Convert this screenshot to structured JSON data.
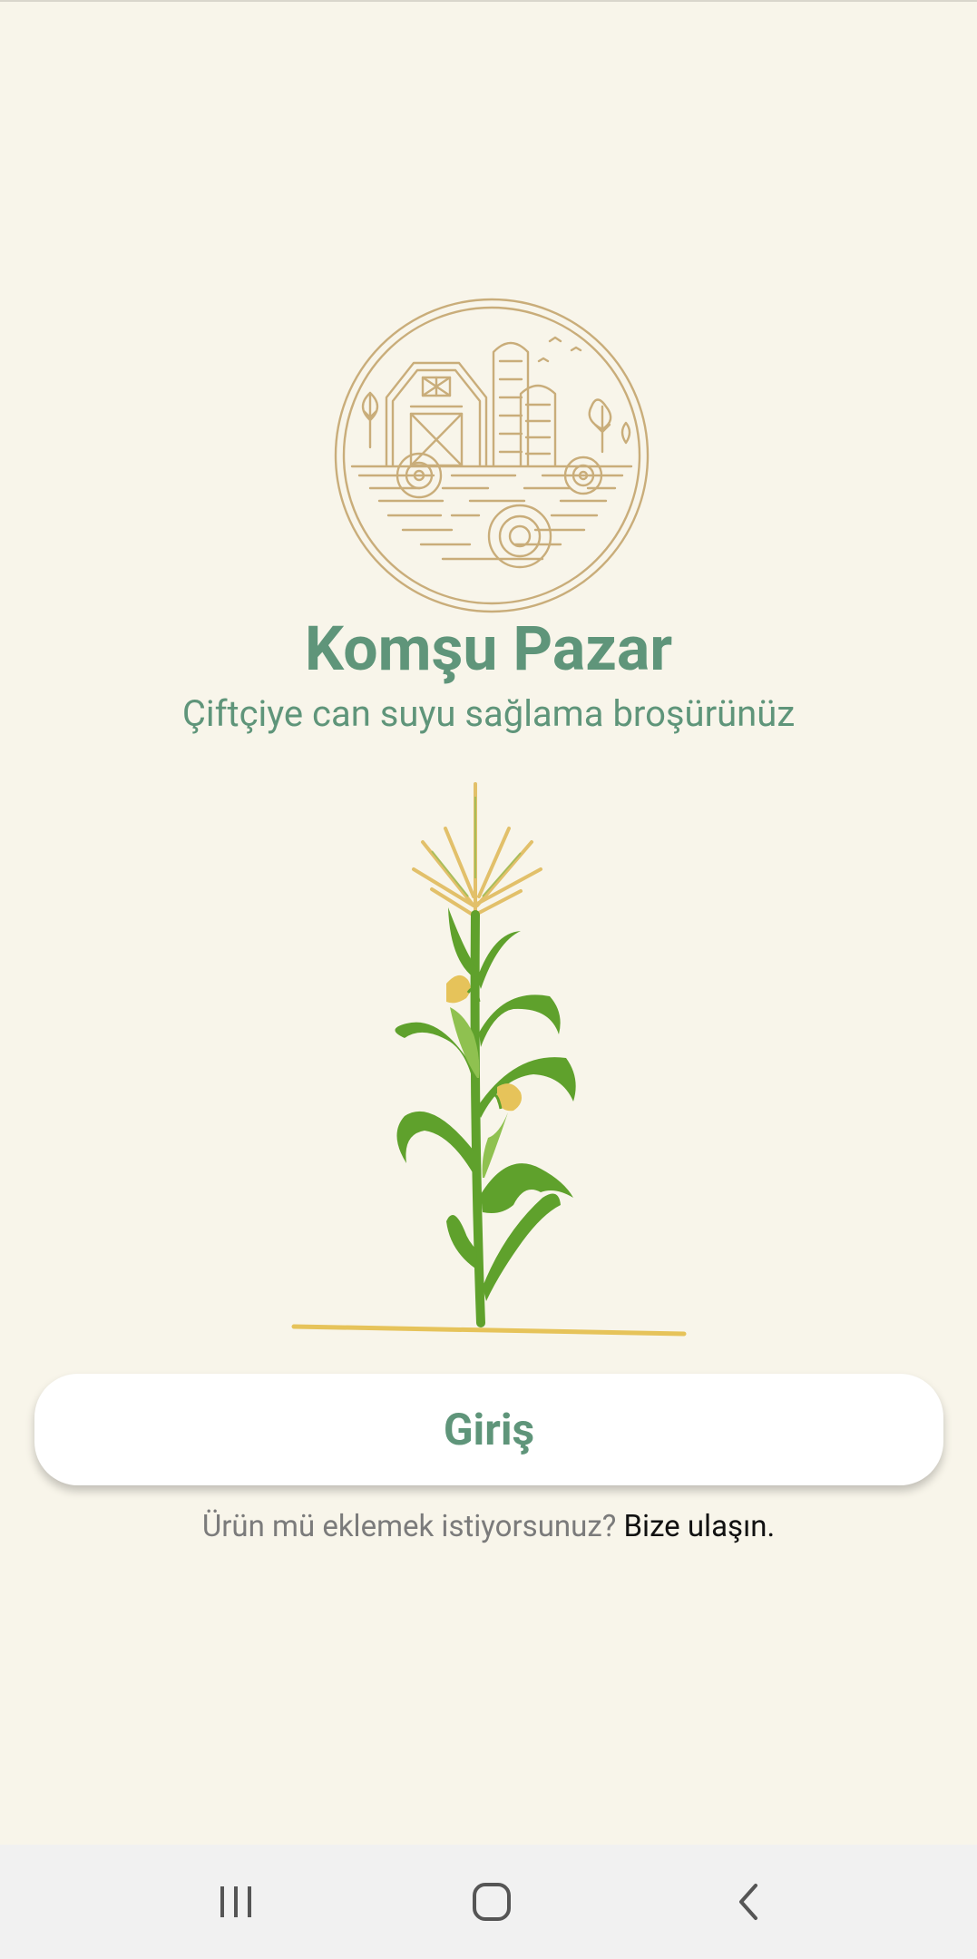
{
  "app": {
    "title": "Komşu Pazar",
    "subtitle": "Çiftçiye can suyu sağlama broşürünüz"
  },
  "login": {
    "label": "Giriş"
  },
  "contact": {
    "question": "Ürün mü eklemek istiyorsunuz?",
    "link": "Bize ulaşın."
  },
  "colors": {
    "background": "#f8f5ea",
    "brand_green": "#5f957a",
    "logo_gold": "#c9ad7a",
    "plant_green": "#5fa12c",
    "corn_yellow": "#e6c35a"
  },
  "icons": {
    "logo": "farm-barn-logo",
    "illustration": "corn-plant-illustration",
    "nav_recents": "recents-icon",
    "nav_home": "home-icon",
    "nav_back": "back-icon"
  }
}
